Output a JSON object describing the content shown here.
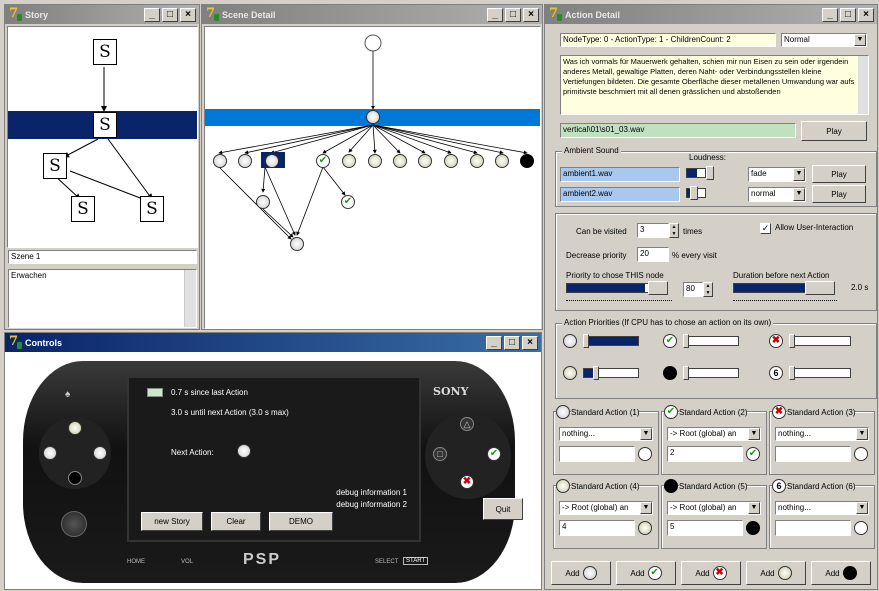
{
  "story": {
    "title": "Story",
    "nodes": [
      "S",
      "S",
      "S",
      "S",
      "S"
    ],
    "scene_name": "Szene 1",
    "scene_text": "Erwachen"
  },
  "scene": {
    "title": "Scene Detail"
  },
  "action": {
    "title": "Action Detail",
    "node_info": "NodeType: 0 - ActionType: 1 - ChildrenCount: 2",
    "mode": "Normal",
    "description": "Was ich vormals für Mauerwerk gehalten, schien mir nun Eisen zu sein oder irgendein anderes Metall, gewaltige Platten, deren Naht- oder Verbindungsstellen kleine Vertiefungen bildeten. Die gesamte Oberfläche dieser metallenen Umwandung war aufs primitivste beschmiert mit all denen grässlichen und abstoßenden",
    "audio_file": "vertical\\01\\s01_03.wav",
    "play": "Play",
    "ambient_label": "Ambient Sound",
    "loudness_label": "Loudness:",
    "ambient": [
      {
        "file": "ambient1.wav",
        "mode": "fade",
        "loudness": 0.55
      },
      {
        "file": "ambient2.wav",
        "mode": "normal",
        "loudness": 0.2
      }
    ],
    "can_visit_label": "Can be visited",
    "can_visit": "3",
    "times_label": "times",
    "allow_label": "Allow User-Interaction",
    "decrease_label": "Decrease priority",
    "decrease": "20",
    "per_visit_label": "% every visit",
    "priority_label": "Priority to chose THIS node",
    "priority": "80",
    "duration_label": "Duration before next Action",
    "duration": "2.0 s",
    "priorities_label": "Action Priorities (If CPU has to chose an action on its own)",
    "standard": [
      {
        "label": "Standard Action (1)",
        "value": "nothing...",
        "num": ""
      },
      {
        "label": "Standard Action (2)",
        "value": "-> Root (global) an",
        "num": "2"
      },
      {
        "label": "Standard Action (3)",
        "value": "nothing...",
        "num": ""
      },
      {
        "label": "Standard Action (4)",
        "value": "-> Root (global) an",
        "num": "4"
      },
      {
        "label": "Standard Action (5)",
        "value": "-> Root (global) an",
        "num": "5"
      },
      {
        "label": "Standard Action (6)",
        "value": "nothing...",
        "num": ""
      }
    ],
    "add": "Add"
  },
  "controls": {
    "title": "Controls",
    "since": "0.7 s since last Action",
    "until": "3.0 s until next Action (3.0 s max)",
    "next": "Next Action:",
    "debug1": "debug information 1",
    "debug2": "debug information 2",
    "new_story": "new Story",
    "clear": "Clear",
    "demo": "DEMO",
    "quit": "Quit",
    "sony": "SONY",
    "home": "HOME",
    "vol": "VOL",
    "select": "SELECT",
    "start": "START"
  }
}
